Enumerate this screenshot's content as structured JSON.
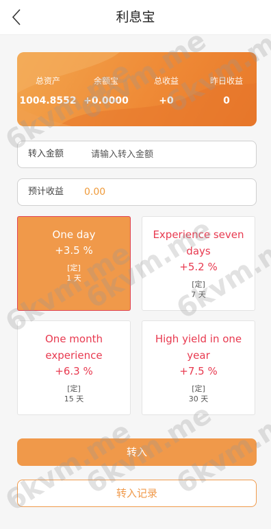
{
  "header": {
    "title": "利息宝",
    "back_icon": "chevron-left-icon"
  },
  "stats": [
    {
      "label": "总资产",
      "value": "1004.8552"
    },
    {
      "label": "余额宝",
      "value": "+0.0000"
    },
    {
      "label": "总收益",
      "value": "+0"
    },
    {
      "label": "昨日收益",
      "value": "0"
    }
  ],
  "transfer_amount": {
    "label": "转入金额",
    "placeholder": "请输入转入金额",
    "value": ""
  },
  "estimated_income": {
    "label": "预计收益",
    "value": "0.00"
  },
  "plans": [
    {
      "name": "One day",
      "rate": "+3.5 %",
      "type": "[定]",
      "days": "1 天",
      "selected": true
    },
    {
      "name": "Experience seven days",
      "rate": "+5.2 %",
      "type": "[定]",
      "days": "7 天",
      "selected": false
    },
    {
      "name": "One month experience",
      "rate": "+6.3 %",
      "type": "[定]",
      "days": "15 天",
      "selected": false
    },
    {
      "name": "High yield in one year",
      "rate": "+7.5 %",
      "type": "[定]",
      "days": "30 天",
      "selected": false
    }
  ],
  "buttons": {
    "transfer_in": "转入",
    "transfer_record": "转入记录"
  },
  "watermark_text": "6kvm.me",
  "colors": {
    "accent": "#f0994a",
    "plan_text": "#e8394f",
    "selected_border": "#e04355"
  }
}
